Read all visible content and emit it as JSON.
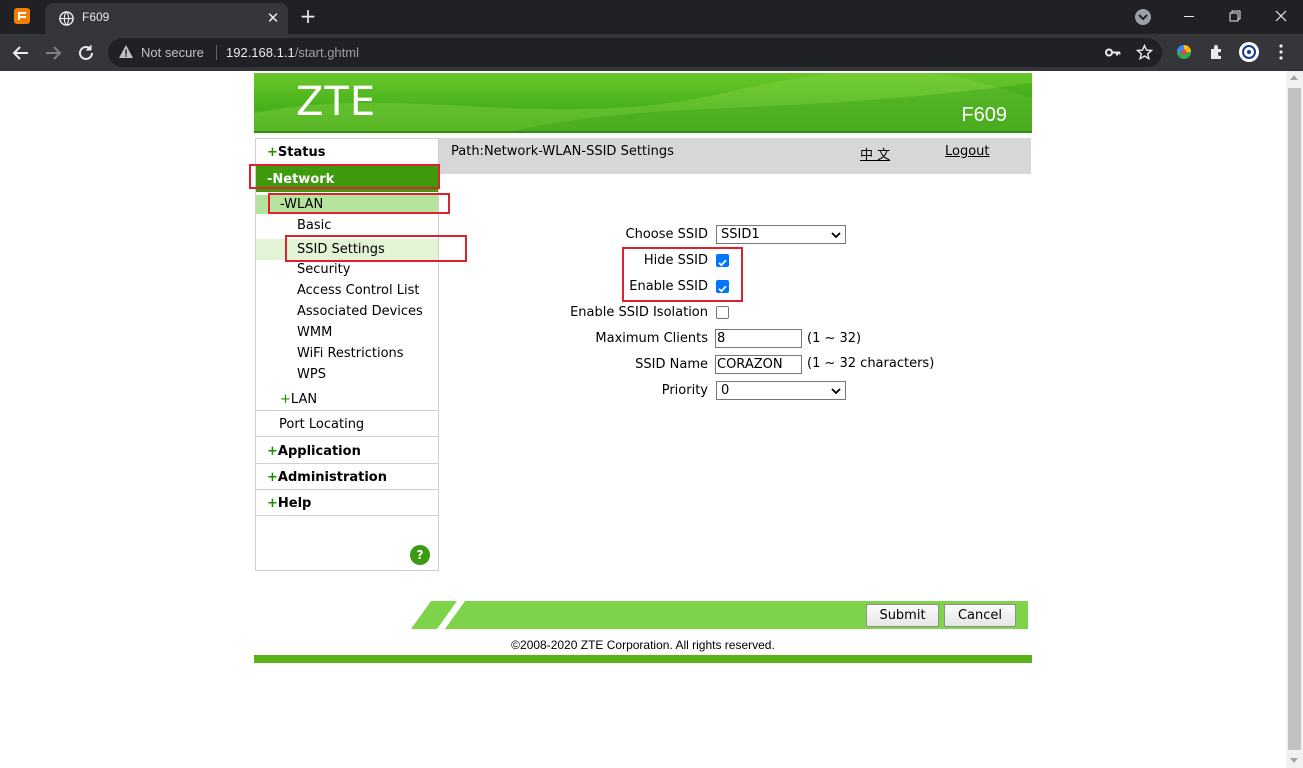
{
  "browser": {
    "tab_title": "F609",
    "omnibox_security": "Not secure",
    "url_host": "192.168.1.1",
    "url_path": "/start.ghtml"
  },
  "header": {
    "logo": "ZTE",
    "model": "F609"
  },
  "path": {
    "text": "Path:Network-WLAN-SSID Settings",
    "language_link": "中 文",
    "logout_link": "Logout"
  },
  "nav": {
    "status": "Status",
    "network": "-Network",
    "wlan": "-WLAN",
    "wlan_items": [
      "Basic",
      "SSID Settings",
      "Security",
      "Access Control List",
      "Associated Devices",
      "WMM",
      "WiFi Restrictions",
      "WPS"
    ],
    "lan": "LAN",
    "port_locating": "Port Locating",
    "application": "Application",
    "administration": "Administration",
    "help": "Help",
    "help_icon": "?",
    "plus": "+"
  },
  "form": {
    "choose_ssid_label": "Choose SSID",
    "choose_ssid_value": "SSID1",
    "hide_ssid_label": "Hide SSID",
    "hide_ssid_checked": true,
    "enable_ssid_label": "Enable SSID",
    "enable_ssid_checked": true,
    "isolation_label": "Enable SSID Isolation",
    "isolation_checked": false,
    "max_clients_label": "Maximum Clients",
    "max_clients_value": "8",
    "max_clients_hint": "(1 ~ 32)",
    "ssid_name_label": "SSID Name",
    "ssid_name_value": "CORAZON",
    "ssid_name_hint": "(1 ~ 32 characters)",
    "priority_label": "Priority",
    "priority_value": "0"
  },
  "buttons": {
    "submit": "Submit",
    "cancel": "Cancel"
  },
  "footer": {
    "copyright": "©2008-2020 ZTE Corporation. All rights reserved."
  },
  "colors": {
    "brand_green": "#4ab31c",
    "nav_active": "#3f9a0d",
    "highlight_red": "#d9232e"
  }
}
